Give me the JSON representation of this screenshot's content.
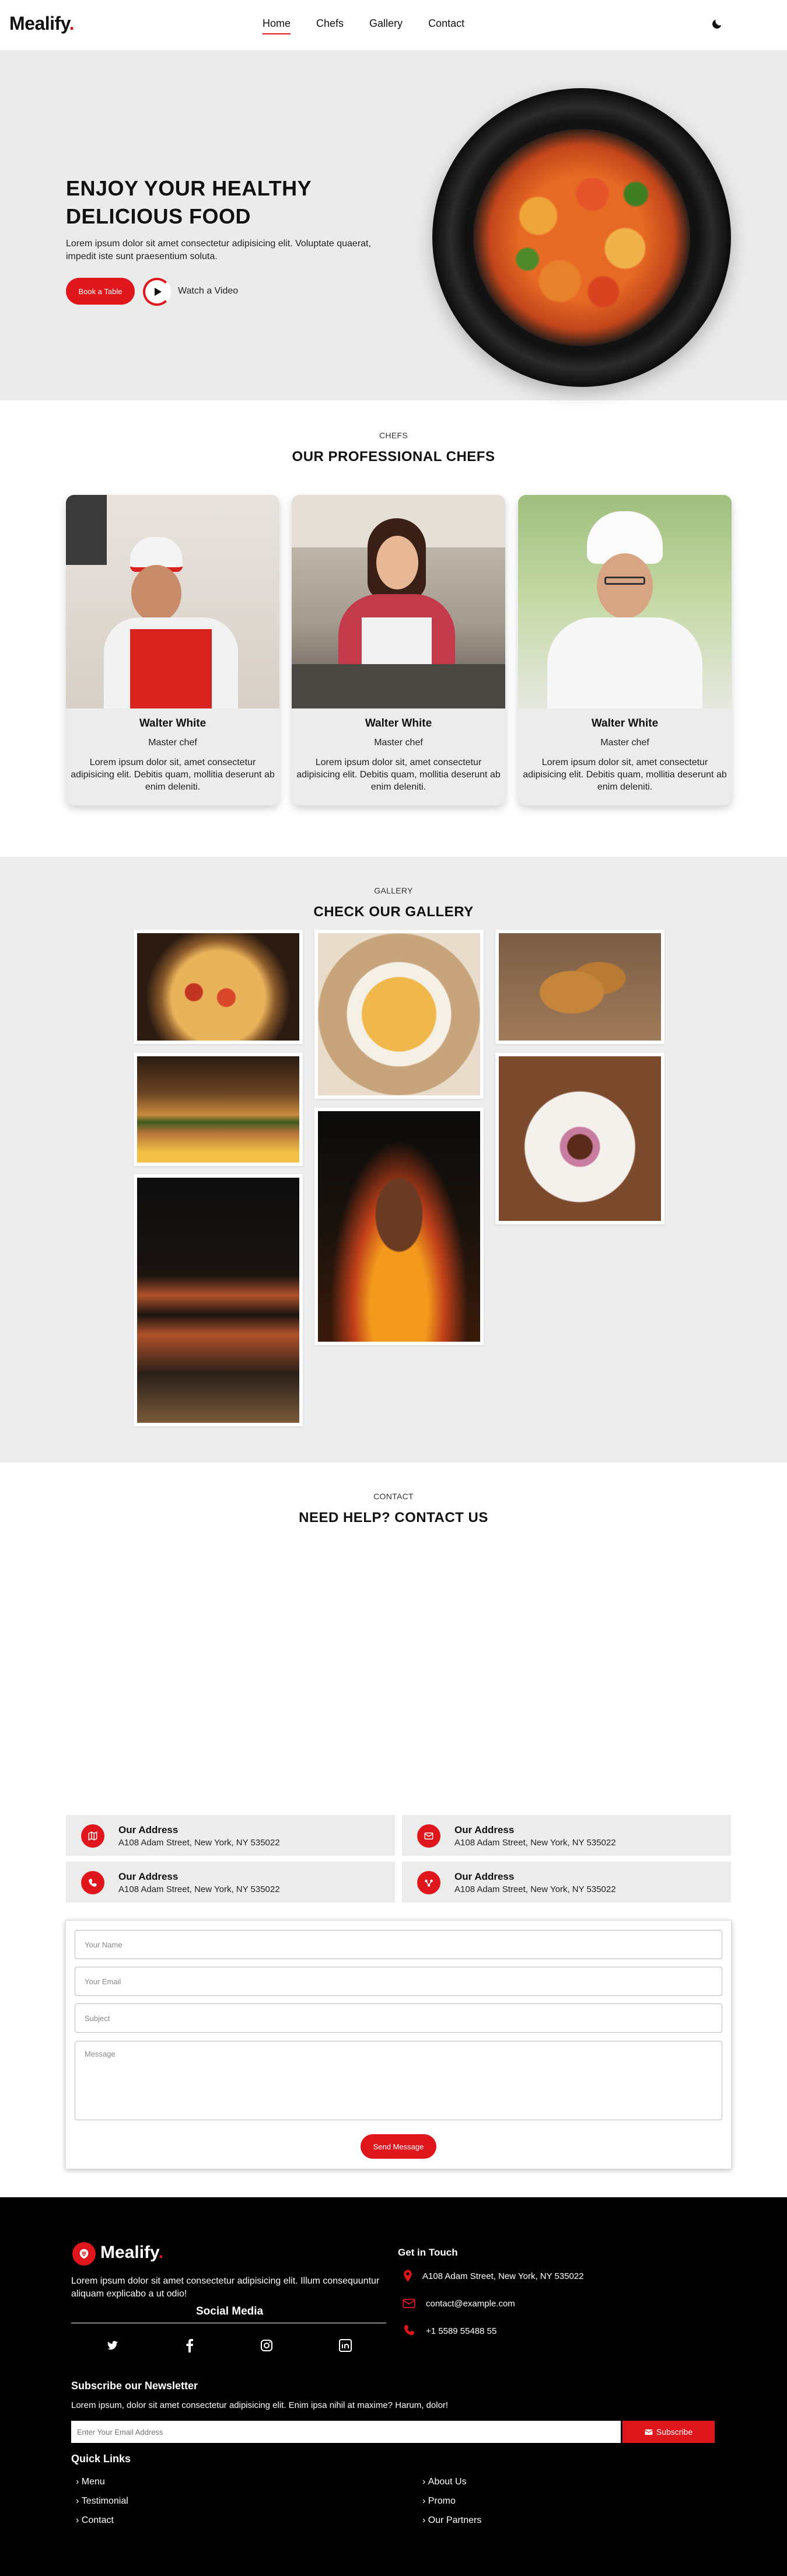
{
  "brand": {
    "name": "Mealify",
    "dot": "."
  },
  "nav": {
    "items": [
      "Home",
      "Chefs",
      "Gallery",
      "Contact"
    ],
    "active": "Home",
    "theme_icon": "moon-icon"
  },
  "hero": {
    "title_line1": "ENJOY YOUR HEALTHY",
    "title_line2": "DELICIOUS FOOD",
    "text": "Lorem ipsum dolor sit amet consectetur adipisicing elit. Voluptate quaerat, impedit iste sunt praesentium soluta.",
    "book_label": "Book a Table",
    "watch_label": "Watch a Video"
  },
  "chefs": {
    "label": "CHEFS",
    "title": "OUR PROFESSIONAL CHEFS",
    "items": [
      {
        "name": "Walter White",
        "role": "Master chef",
        "desc": "Lorem ipsum dolor sit, amet consectetur adipisicing elit. Debitis quam, mollitia deserunt ab enim deleniti."
      },
      {
        "name": "Walter White",
        "role": "Master chef",
        "desc": "Lorem ipsum dolor sit, amet consectetur adipisicing elit. Debitis quam, mollitia deserunt ab enim deleniti."
      },
      {
        "name": "Walter White",
        "role": "Master chef",
        "desc": "Lorem ipsum dolor sit, amet consectetur adipisicing elit. Debitis quam, mollitia deserunt ab enim deleniti."
      }
    ]
  },
  "gallery": {
    "label": "GALLERY",
    "title": "CHECK OUR GALLERY"
  },
  "contact": {
    "label": "CONTACT",
    "title": "NEED HELP? CONTACT US",
    "cards": [
      {
        "title": "Our Address",
        "text": "A108 Adam Street, New York, NY 535022",
        "icon": "map-icon"
      },
      {
        "title": "Our Address",
        "text": "A108 Adam Street, New York, NY 535022",
        "icon": "envelope-icon"
      },
      {
        "title": "Our Address",
        "text": "A108 Adam Street, New York, NY 535022",
        "icon": "phone-icon"
      },
      {
        "title": "Our Address",
        "text": "A108 Adam Street, New York, NY 535022",
        "icon": "share-icon"
      }
    ],
    "form": {
      "name_placeholder": "Your Name",
      "email_placeholder": "Your Email",
      "subject_placeholder": "Subject",
      "message_placeholder": "Message",
      "send_label": "Send Message"
    }
  },
  "footer": {
    "about": "Lorem ipsum dolor sit amet consectetur adipisicing elit. Illum consequuntur aliquam explicabo a ut odio!",
    "social_title": "Social Media",
    "get_in_touch": "Get in Touch",
    "address": "A108 Adam Street, New York, NY 535022",
    "email": "contact@example.com",
    "phone": "+1 5589 55488 55",
    "newsletter_title": "Subscribe our Newsletter",
    "newsletter_text": "Lorem ipsum, dolor sit amet consectetur adipisicing elit. Enim ipsa nihil at maxime? Harum, dolor!",
    "newsletter_placeholder": "Enter Your Email Address",
    "subscribe_label": "Subscribe",
    "quick_links_title": "Quick Links",
    "links_left": [
      "Menu",
      "Testimonial",
      "Contact"
    ],
    "links_right": [
      "About Us",
      "Promo",
      "Our Partners"
    ]
  },
  "colors": {
    "accent": "#e0161d",
    "hero_bg": "#ebebeb",
    "footer_bg": "#000000"
  }
}
